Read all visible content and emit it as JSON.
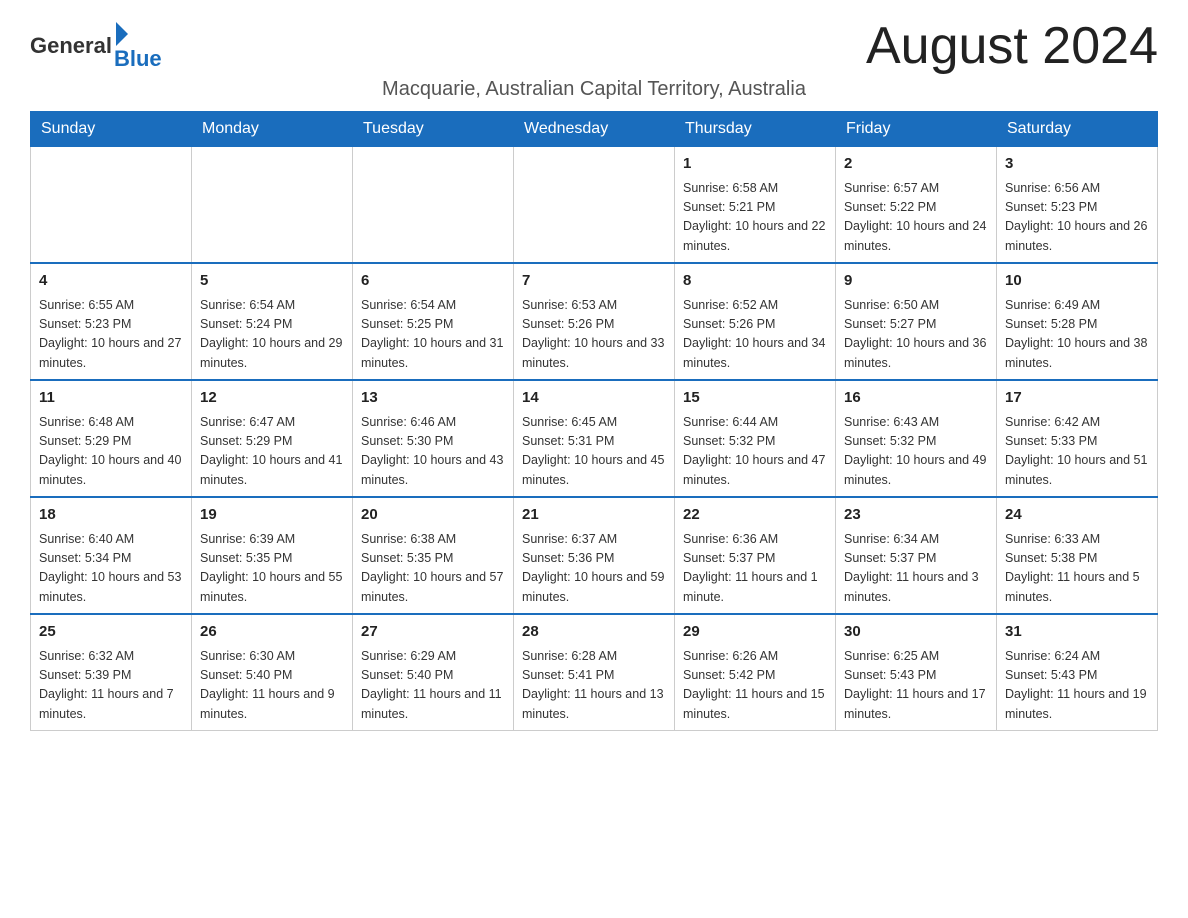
{
  "header": {
    "logo_general": "General",
    "logo_blue": "Blue",
    "month_title": "August 2024",
    "location": "Macquarie, Australian Capital Territory, Australia"
  },
  "weekdays": [
    "Sunday",
    "Monday",
    "Tuesday",
    "Wednesday",
    "Thursday",
    "Friday",
    "Saturday"
  ],
  "weeks": [
    [
      {
        "day": "",
        "sunrise": "",
        "sunset": "",
        "daylight": ""
      },
      {
        "day": "",
        "sunrise": "",
        "sunset": "",
        "daylight": ""
      },
      {
        "day": "",
        "sunrise": "",
        "sunset": "",
        "daylight": ""
      },
      {
        "day": "",
        "sunrise": "",
        "sunset": "",
        "daylight": ""
      },
      {
        "day": "1",
        "sunrise": "Sunrise: 6:58 AM",
        "sunset": "Sunset: 5:21 PM",
        "daylight": "Daylight: 10 hours and 22 minutes."
      },
      {
        "day": "2",
        "sunrise": "Sunrise: 6:57 AM",
        "sunset": "Sunset: 5:22 PM",
        "daylight": "Daylight: 10 hours and 24 minutes."
      },
      {
        "day": "3",
        "sunrise": "Sunrise: 6:56 AM",
        "sunset": "Sunset: 5:23 PM",
        "daylight": "Daylight: 10 hours and 26 minutes."
      }
    ],
    [
      {
        "day": "4",
        "sunrise": "Sunrise: 6:55 AM",
        "sunset": "Sunset: 5:23 PM",
        "daylight": "Daylight: 10 hours and 27 minutes."
      },
      {
        "day": "5",
        "sunrise": "Sunrise: 6:54 AM",
        "sunset": "Sunset: 5:24 PM",
        "daylight": "Daylight: 10 hours and 29 minutes."
      },
      {
        "day": "6",
        "sunrise": "Sunrise: 6:54 AM",
        "sunset": "Sunset: 5:25 PM",
        "daylight": "Daylight: 10 hours and 31 minutes."
      },
      {
        "day": "7",
        "sunrise": "Sunrise: 6:53 AM",
        "sunset": "Sunset: 5:26 PM",
        "daylight": "Daylight: 10 hours and 33 minutes."
      },
      {
        "day": "8",
        "sunrise": "Sunrise: 6:52 AM",
        "sunset": "Sunset: 5:26 PM",
        "daylight": "Daylight: 10 hours and 34 minutes."
      },
      {
        "day": "9",
        "sunrise": "Sunrise: 6:50 AM",
        "sunset": "Sunset: 5:27 PM",
        "daylight": "Daylight: 10 hours and 36 minutes."
      },
      {
        "day": "10",
        "sunrise": "Sunrise: 6:49 AM",
        "sunset": "Sunset: 5:28 PM",
        "daylight": "Daylight: 10 hours and 38 minutes."
      }
    ],
    [
      {
        "day": "11",
        "sunrise": "Sunrise: 6:48 AM",
        "sunset": "Sunset: 5:29 PM",
        "daylight": "Daylight: 10 hours and 40 minutes."
      },
      {
        "day": "12",
        "sunrise": "Sunrise: 6:47 AM",
        "sunset": "Sunset: 5:29 PM",
        "daylight": "Daylight: 10 hours and 41 minutes."
      },
      {
        "day": "13",
        "sunrise": "Sunrise: 6:46 AM",
        "sunset": "Sunset: 5:30 PM",
        "daylight": "Daylight: 10 hours and 43 minutes."
      },
      {
        "day": "14",
        "sunrise": "Sunrise: 6:45 AM",
        "sunset": "Sunset: 5:31 PM",
        "daylight": "Daylight: 10 hours and 45 minutes."
      },
      {
        "day": "15",
        "sunrise": "Sunrise: 6:44 AM",
        "sunset": "Sunset: 5:32 PM",
        "daylight": "Daylight: 10 hours and 47 minutes."
      },
      {
        "day": "16",
        "sunrise": "Sunrise: 6:43 AM",
        "sunset": "Sunset: 5:32 PM",
        "daylight": "Daylight: 10 hours and 49 minutes."
      },
      {
        "day": "17",
        "sunrise": "Sunrise: 6:42 AM",
        "sunset": "Sunset: 5:33 PM",
        "daylight": "Daylight: 10 hours and 51 minutes."
      }
    ],
    [
      {
        "day": "18",
        "sunrise": "Sunrise: 6:40 AM",
        "sunset": "Sunset: 5:34 PM",
        "daylight": "Daylight: 10 hours and 53 minutes."
      },
      {
        "day": "19",
        "sunrise": "Sunrise: 6:39 AM",
        "sunset": "Sunset: 5:35 PM",
        "daylight": "Daylight: 10 hours and 55 minutes."
      },
      {
        "day": "20",
        "sunrise": "Sunrise: 6:38 AM",
        "sunset": "Sunset: 5:35 PM",
        "daylight": "Daylight: 10 hours and 57 minutes."
      },
      {
        "day": "21",
        "sunrise": "Sunrise: 6:37 AM",
        "sunset": "Sunset: 5:36 PM",
        "daylight": "Daylight: 10 hours and 59 minutes."
      },
      {
        "day": "22",
        "sunrise": "Sunrise: 6:36 AM",
        "sunset": "Sunset: 5:37 PM",
        "daylight": "Daylight: 11 hours and 1 minute."
      },
      {
        "day": "23",
        "sunrise": "Sunrise: 6:34 AM",
        "sunset": "Sunset: 5:37 PM",
        "daylight": "Daylight: 11 hours and 3 minutes."
      },
      {
        "day": "24",
        "sunrise": "Sunrise: 6:33 AM",
        "sunset": "Sunset: 5:38 PM",
        "daylight": "Daylight: 11 hours and 5 minutes."
      }
    ],
    [
      {
        "day": "25",
        "sunrise": "Sunrise: 6:32 AM",
        "sunset": "Sunset: 5:39 PM",
        "daylight": "Daylight: 11 hours and 7 minutes."
      },
      {
        "day": "26",
        "sunrise": "Sunrise: 6:30 AM",
        "sunset": "Sunset: 5:40 PM",
        "daylight": "Daylight: 11 hours and 9 minutes."
      },
      {
        "day": "27",
        "sunrise": "Sunrise: 6:29 AM",
        "sunset": "Sunset: 5:40 PM",
        "daylight": "Daylight: 11 hours and 11 minutes."
      },
      {
        "day": "28",
        "sunrise": "Sunrise: 6:28 AM",
        "sunset": "Sunset: 5:41 PM",
        "daylight": "Daylight: 11 hours and 13 minutes."
      },
      {
        "day": "29",
        "sunrise": "Sunrise: 6:26 AM",
        "sunset": "Sunset: 5:42 PM",
        "daylight": "Daylight: 11 hours and 15 minutes."
      },
      {
        "day": "30",
        "sunrise": "Sunrise: 6:25 AM",
        "sunset": "Sunset: 5:43 PM",
        "daylight": "Daylight: 11 hours and 17 minutes."
      },
      {
        "day": "31",
        "sunrise": "Sunrise: 6:24 AM",
        "sunset": "Sunset: 5:43 PM",
        "daylight": "Daylight: 11 hours and 19 minutes."
      }
    ]
  ]
}
